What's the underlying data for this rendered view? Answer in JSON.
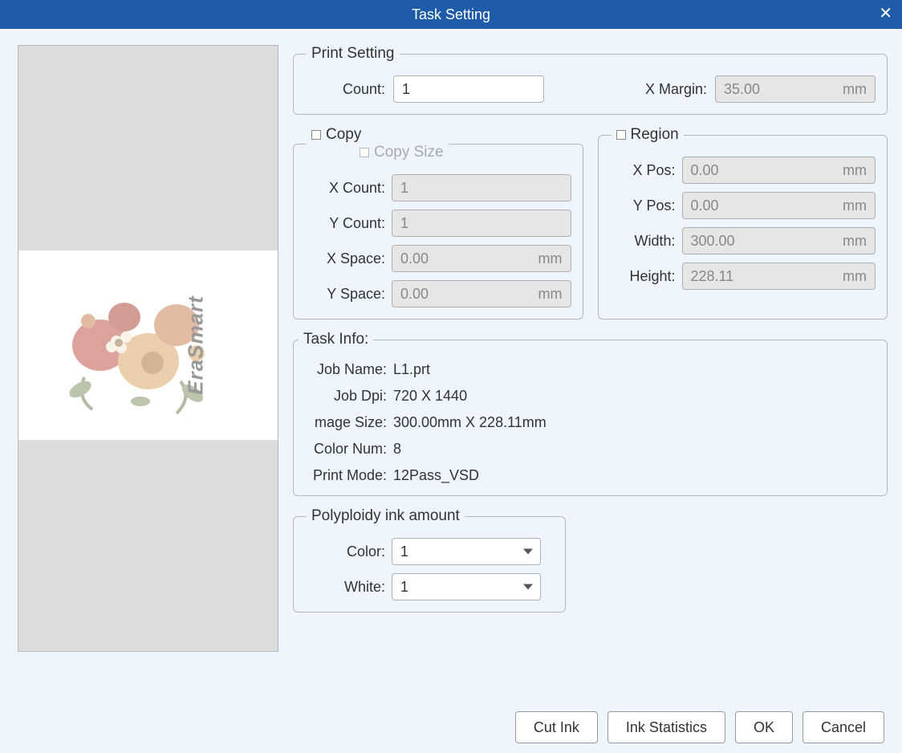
{
  "window": {
    "title": "Task Setting",
    "close_symbol": "✕"
  },
  "print_setting": {
    "legend": "Print Setting",
    "count_label": "Count:",
    "count_value": "1",
    "xmargin_label": "X Margin:",
    "xmargin_value": "35.00",
    "xmargin_unit": "mm"
  },
  "copy": {
    "legend": "Copy",
    "size_legend": "Copy Size",
    "xcount_label": "X Count:",
    "xcount_value": "1",
    "ycount_label": "Y Count:",
    "ycount_value": "1",
    "xspace_label": "X Space:",
    "xspace_value": "0.00",
    "xspace_unit": "mm",
    "yspace_label": "Y Space:",
    "yspace_value": "0.00",
    "yspace_unit": "mm"
  },
  "region": {
    "legend": "Region",
    "xpos_label": "X Pos:",
    "xpos_value": "0.00",
    "xpos_unit": "mm",
    "ypos_label": "Y Pos:",
    "ypos_value": "0.00",
    "ypos_unit": "mm",
    "width_label": "Width:",
    "width_value": "300.00",
    "width_unit": "mm",
    "height_label": "Height:",
    "height_value": "228.11",
    "height_unit": "mm"
  },
  "task_info": {
    "legend": "Task Info:",
    "job_name_label": "Job Name:",
    "job_name_value": "L1.prt",
    "job_dpi_label": "Job Dpi:",
    "job_dpi_value": "720 X 1440",
    "image_size_label": "mage Size:",
    "image_size_value": "300.00mm X 228.11mm",
    "color_num_label": "Color Num:",
    "color_num_value": "8",
    "print_mode_label": "Print Mode:",
    "print_mode_value": "12Pass_VSD"
  },
  "ink": {
    "legend": "Polyploidy ink amount",
    "color_label": "Color:",
    "color_value": "1",
    "white_label": "White:",
    "white_value": "1"
  },
  "buttons": {
    "cut_ink": "Cut Ink",
    "ink_stats": "Ink Statistics",
    "ok": "OK",
    "cancel": "Cancel"
  },
  "preview": {
    "watermark": "EraSmart"
  }
}
